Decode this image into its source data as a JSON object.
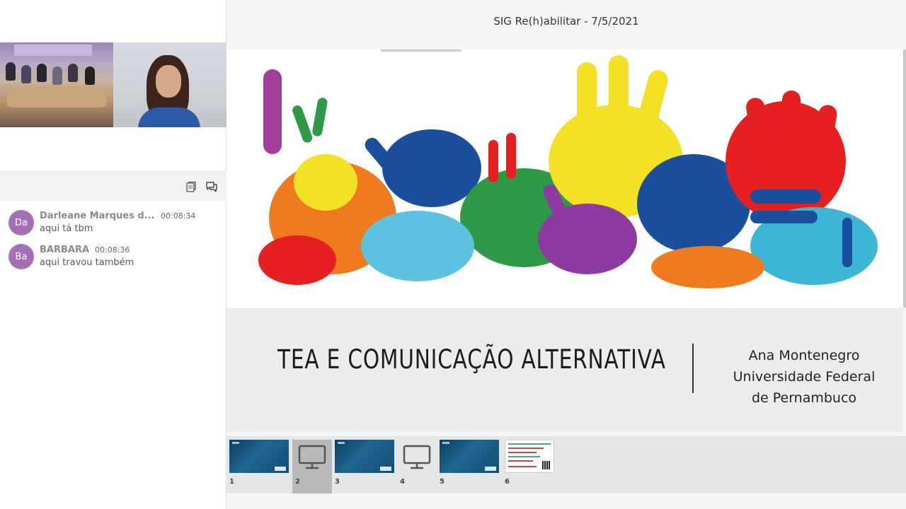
{
  "meeting": {
    "title": "SIG Re(h)abilitar - 7/5/2021"
  },
  "chat": {
    "messages": [
      {
        "initials": "Da",
        "name": "Darleane Marques d...",
        "time": "00:08:34",
        "text": "aqui tá tbm"
      },
      {
        "initials": "Ba",
        "name": "BARBARA",
        "time": "00:08:36",
        "text": "aqui travou também"
      }
    ],
    "avatar_color": "#a56fb7"
  },
  "slide": {
    "title": "TEA E COMUNICAÇÃO ALTERNATIVA",
    "author_lines": [
      "Ana Montenegro",
      "Universidade Federal",
      "de Pernambuco"
    ]
  },
  "thumbnails": [
    {
      "number": "1",
      "kind": "image"
    },
    {
      "number": "2",
      "kind": "screen",
      "selected": true
    },
    {
      "number": "3",
      "kind": "image"
    },
    {
      "number": "4",
      "kind": "screen"
    },
    {
      "number": "5",
      "kind": "image"
    },
    {
      "number": "6",
      "kind": "poster"
    }
  ],
  "icons": {
    "copy": "copy-icon",
    "chat": "chat-bubbles-icon",
    "screen": "monitor-icon",
    "cursor": "mouse-cursor-icon"
  }
}
